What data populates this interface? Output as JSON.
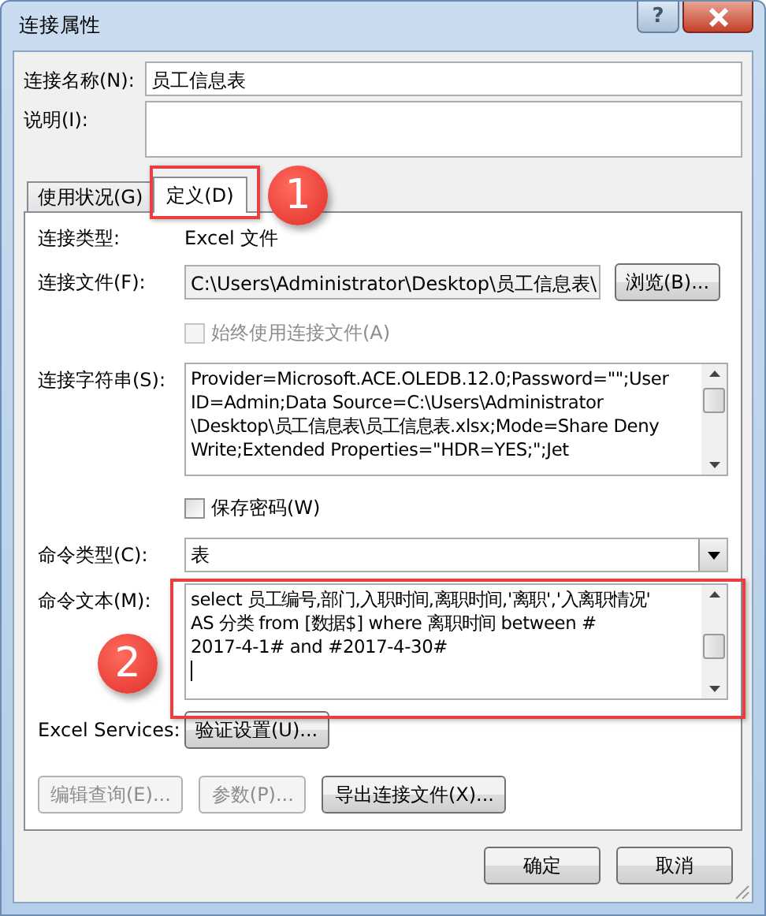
{
  "window": {
    "title": "连接属性",
    "help_button": "?"
  },
  "name_field": {
    "label": "连接名称(N):",
    "value": "员工信息表"
  },
  "description_field": {
    "label": "说明(I):"
  },
  "tabs": [
    {
      "label": "使用状况(G)",
      "selected": false
    },
    {
      "label": "定义(D)",
      "selected": true
    }
  ],
  "definition": {
    "connection_type": {
      "label": "连接类型:",
      "value": "Excel 文件"
    },
    "connection_file": {
      "label": "连接文件(F):",
      "value": "C:\\Users\\Administrator\\Desktop\\员工信息表\\",
      "button": "浏览(B)..."
    },
    "always_use_file": {
      "label": "始终使用连接文件(A)",
      "checked": false,
      "disabled": true
    },
    "connection_string": {
      "label": "连接字符串(S):",
      "lines": [
        "Provider=Microsoft.ACE.OLEDB.12.0;Password=\"\";User",
        "ID=Admin;Data Source=C:\\Users\\Administrator",
        "\\Desktop\\员工信息表\\员工信息表.xlsx;Mode=Share Deny",
        "Write;Extended Properties=\"HDR=YES;\";Jet"
      ]
    },
    "save_password": {
      "label": "保存密码(W)",
      "checked": false,
      "disabled": false
    },
    "command_type": {
      "label": "命令类型(C):",
      "value": "表"
    },
    "command_text": {
      "label": "命令文本(M):",
      "lines": [
        "select 员工编号,部门,入职时间,离职时间,'离职','入离职情况'",
        "AS 分类 from [数据$] where 离职时间 between #",
        "2017-4-1# and #2017-4-30#"
      ]
    },
    "excel_services": {
      "label": "Excel Services:",
      "button": "验证设置(U)..."
    },
    "buttons": [
      {
        "label": "编辑查询(E)...",
        "disabled": true
      },
      {
        "label": "参数(P)...",
        "disabled": true
      },
      {
        "label": "导出连接文件(X)...",
        "disabled": false
      }
    ]
  },
  "annotations": [
    {
      "number": "1"
    },
    {
      "number": "2"
    }
  ],
  "footer_buttons": [
    "确定",
    "取消"
  ]
}
